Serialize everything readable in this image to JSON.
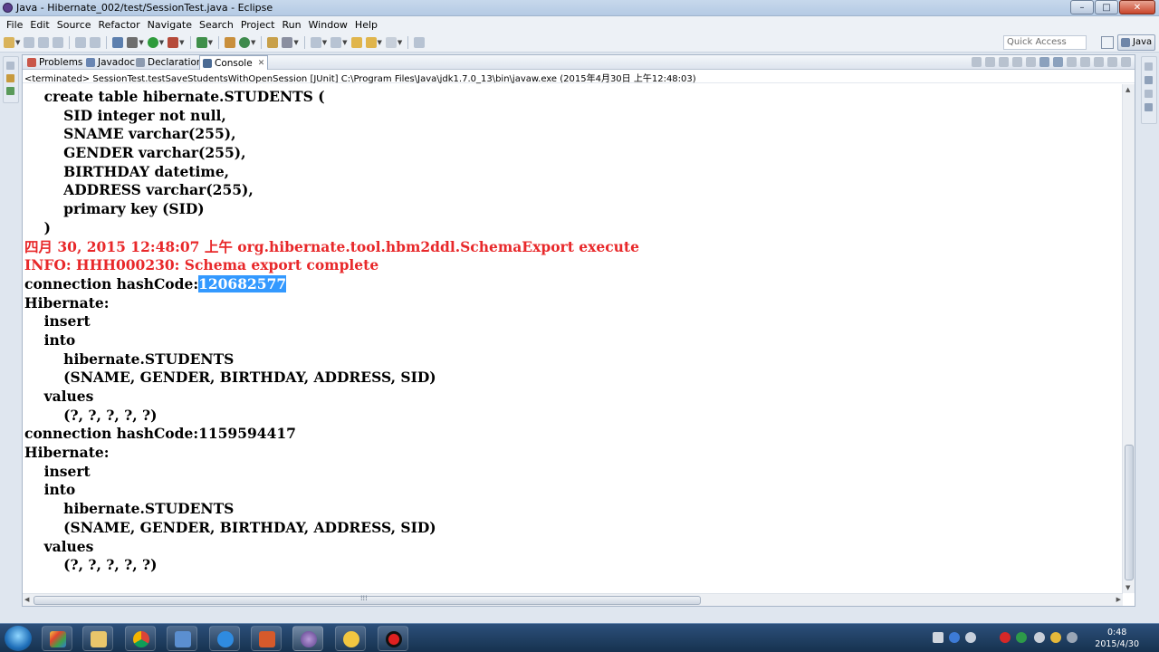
{
  "window": {
    "title": "Java - Hibernate_002/test/SessionTest.java - Eclipse",
    "controls": [
      "–",
      "□",
      "✕"
    ]
  },
  "menu": [
    "File",
    "Edit",
    "Source",
    "Refactor",
    "Navigate",
    "Search",
    "Project",
    "Run",
    "Window",
    "Help"
  ],
  "toolbar": {
    "quick_access_placeholder": "Quick Access",
    "perspective_label": "Java"
  },
  "tabs": [
    {
      "label": "Problems",
      "icon": "problems-icon"
    },
    {
      "label": "Javadoc",
      "icon": "javadoc-icon"
    },
    {
      "label": "Declaration",
      "icon": "declaration-icon"
    },
    {
      "label": "Console",
      "icon": "console-icon",
      "active": true
    }
  ],
  "console": {
    "process_line": "<terminated> SessionTest.testSaveStudentsWithOpenSession [JUnit] C:\\Program Files\\Java\\jdk1.7.0_13\\bin\\javaw.exe (2015年4月30日 上午12:48:03)",
    "lines": [
      {
        "text": "    create table hibernate.STUDENTS ("
      },
      {
        "text": "        SID integer not null,"
      },
      {
        "text": "        SNAME varchar(255),"
      },
      {
        "text": "        GENDER varchar(255),"
      },
      {
        "text": "        BIRTHDAY datetime,"
      },
      {
        "text": "        ADDRESS varchar(255),"
      },
      {
        "text": "        primary key (SID)"
      },
      {
        "text": "    )"
      },
      {
        "text": "四月 30, 2015 12:48:07 上午 org.hibernate.tool.hbm2ddl.SchemaExport execute",
        "style": "err"
      },
      {
        "text": "INFO: HHH000230: Schema export complete",
        "style": "err"
      },
      {
        "text": "connection hashCode:",
        "selected": "120682577"
      },
      {
        "text": "Hibernate: "
      },
      {
        "text": "    insert "
      },
      {
        "text": "    into"
      },
      {
        "text": "        hibernate.STUDENTS"
      },
      {
        "text": "        (SNAME, GENDER, BIRTHDAY, ADDRESS, SID) "
      },
      {
        "text": "    values"
      },
      {
        "text": "        (?, ?, ?, ?, ?)"
      },
      {
        "text": "connection hashCode:1159594417"
      },
      {
        "text": "Hibernate: "
      },
      {
        "text": "    insert "
      },
      {
        "text": "    into"
      },
      {
        "text": "        hibernate.STUDENTS"
      },
      {
        "text": "        (SNAME, GENDER, BIRTHDAY, ADDRESS, SID) "
      },
      {
        "text": "    values"
      },
      {
        "text": "        (?, ?, ?, ?, ?)"
      }
    ]
  },
  "taskbar": {
    "apps": [
      "start-button",
      "app-360",
      "explorer",
      "chrome",
      "task-manager",
      "ie",
      "powerpoint",
      "eclipse",
      "qq",
      "recorder"
    ],
    "clock_time": "0:48",
    "clock_date": "2015/4/30"
  },
  "colors": {
    "error_text": "#e8282a",
    "selection": "#3399ff"
  }
}
